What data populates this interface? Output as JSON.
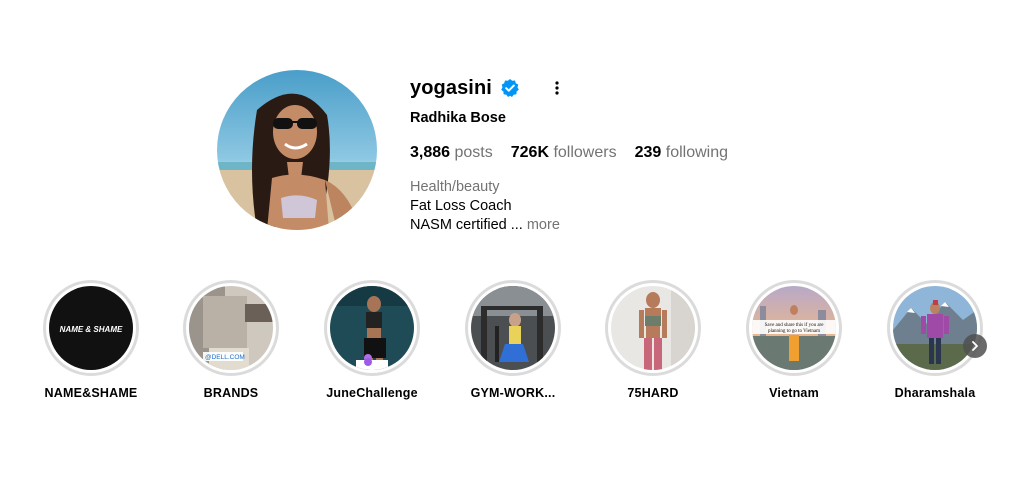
{
  "profile": {
    "username": "yogasini",
    "verified": true,
    "full_name": "Radhika Bose",
    "stats": {
      "posts_count": "3,886",
      "posts_label": "posts",
      "followers_count": "726K",
      "followers_label": "followers",
      "following_count": "239",
      "following_label": "following"
    },
    "category": "Health/beauty",
    "bio_line_1": "Fat Loss Coach",
    "bio_line_2": "NASM certified ...",
    "more_label": "more"
  },
  "highlights": [
    {
      "label": "NAME&SHAME",
      "thumb_text": "NAME & SHAME"
    },
    {
      "label": "BRANDS",
      "thumb_text": "@DELL.COM"
    },
    {
      "label": "JuneChallenge"
    },
    {
      "label": "GYM-WORK..."
    },
    {
      "label": "75HARD"
    },
    {
      "label": "Vietnam",
      "thumb_text_1": "Save and share this if you are",
      "thumb_text_2": "planning to go to Vietnam"
    },
    {
      "label": "Dharamshala"
    }
  ],
  "colors": {
    "verified_blue": "#0095f6",
    "muted_text": "#737373",
    "ring_gray": "#dbdbdb"
  }
}
